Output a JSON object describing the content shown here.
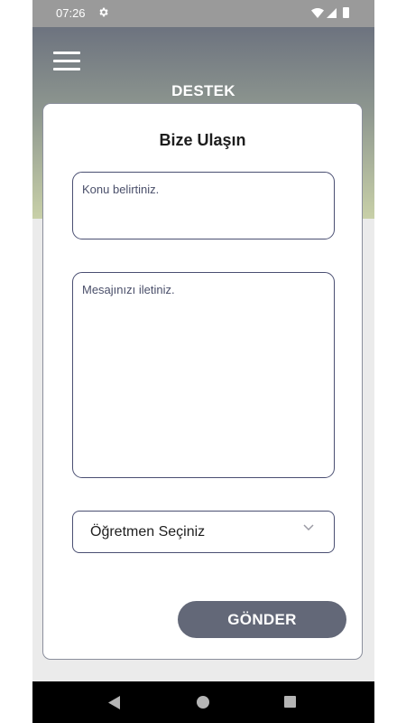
{
  "status_bar": {
    "time": "07:26"
  },
  "header": {
    "title": "DESTEK"
  },
  "card": {
    "title": "Bize Ulaşın",
    "subject_placeholder": "Konu belirtiniz.",
    "message_placeholder": "Mesajınızı iletiniz.",
    "teacher_select": "Öğretmen Seçiniz",
    "submit_label": "GÖNDER"
  },
  "colors": {
    "button": "#636878",
    "field_border": "#4a4f72",
    "header_top": "#6d737f",
    "header_bottom": "#c8d0a8"
  }
}
